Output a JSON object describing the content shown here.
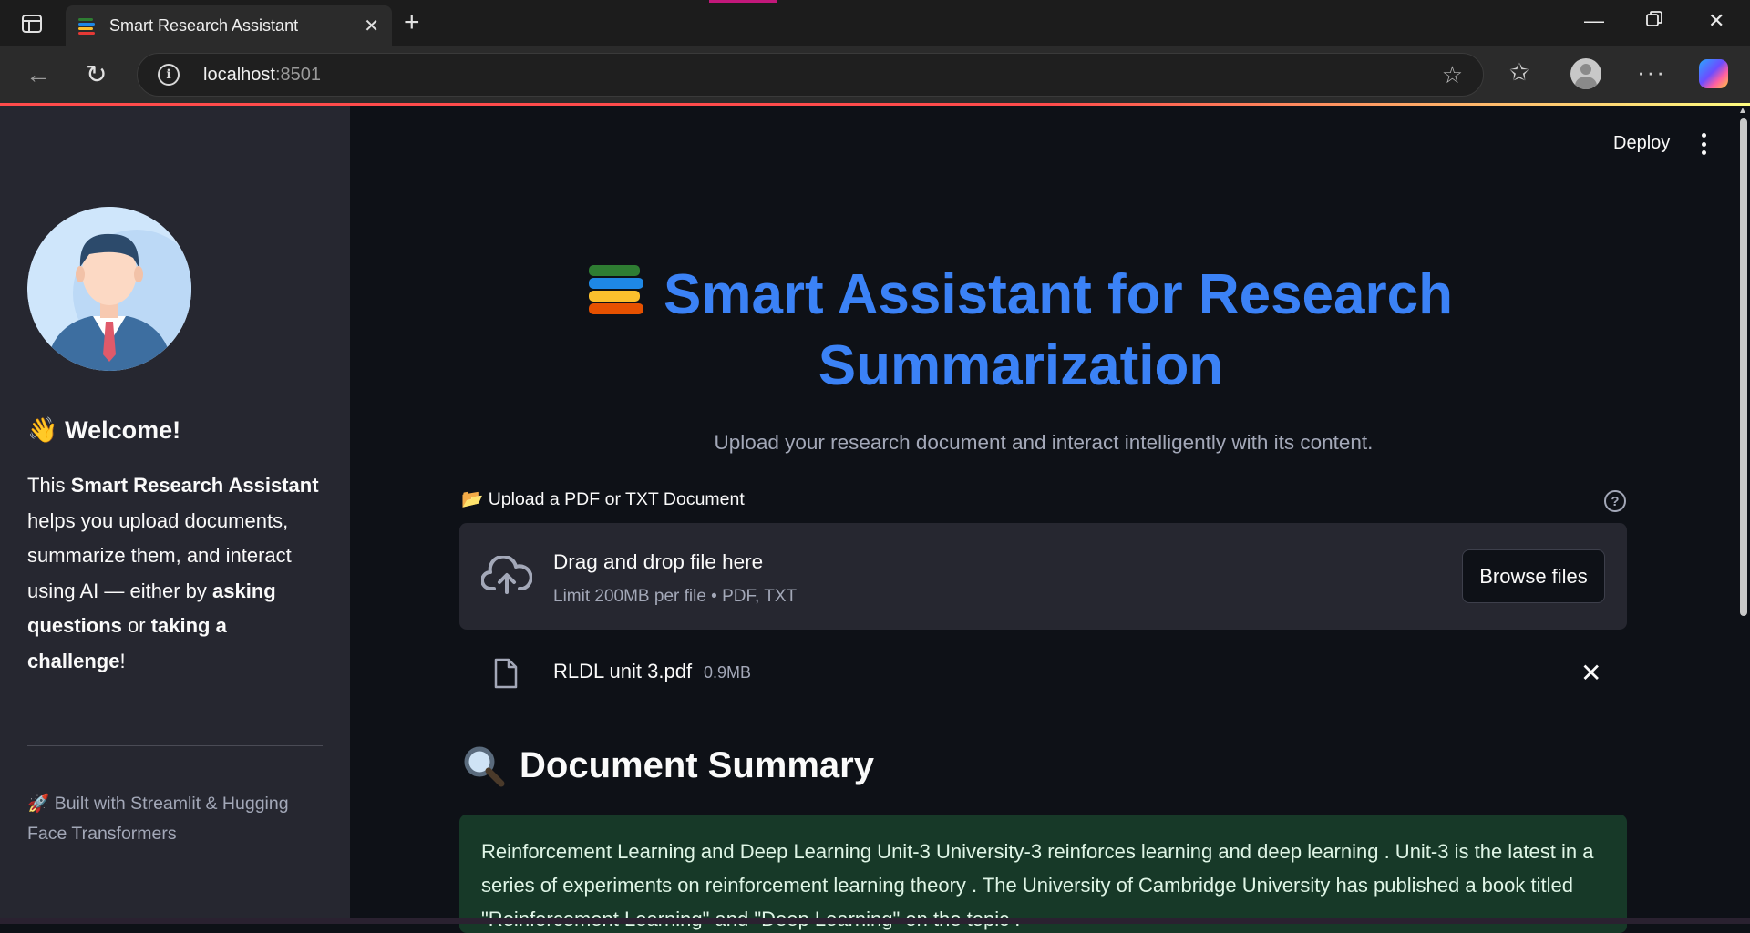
{
  "browser": {
    "tab_title": "Smart Research Assistant",
    "address_host": "localhost",
    "address_port": ":8501"
  },
  "header": {
    "deploy_label": "Deploy"
  },
  "sidebar": {
    "welcome": "Welcome!",
    "welcome_emoji": "👋",
    "about": {
      "p1": "This ",
      "b1": "Smart Research Assistant",
      "p2": " helps you upload documents, summarize them, and interact using AI — either by ",
      "b2": "asking questions",
      "p3": " or ",
      "b3": "taking a challenge",
      "p4": "!"
    },
    "built_emoji": "🚀",
    "built_with": "Built with Streamlit & Hugging Face Transformers"
  },
  "main": {
    "title_line1": "Smart Assistant for Research",
    "title_line2": "Summarization",
    "subtitle": "Upload your research document and interact intelligently with its content.",
    "uploader": {
      "label_emoji": "📂",
      "label": "Upload a PDF or TXT Document",
      "drag_text": "Drag and drop file here",
      "limit_text": "Limit 200MB per file • PDF, TXT",
      "browse_label": "Browse files"
    },
    "uploaded_file": {
      "name": "RLDL unit 3.pdf",
      "size": "0.9MB"
    },
    "summary_heading": "Document Summary",
    "summary_text": "Reinforcement Learning and Deep Learning  Unit-3 University-3 reinforces learning and deep learning . Unit-3 is the latest in a series of experiments on reinforcement learning theory . The University of Cambridge University has published a book titled \"Reinforcement Learning\" and \"Deep Learning\" on the topic ."
  },
  "colors": {
    "accent_blue": "#3b82f6",
    "app_bg": "#0e1117",
    "sidebar_bg": "#262730",
    "success_bg": "#173928"
  }
}
